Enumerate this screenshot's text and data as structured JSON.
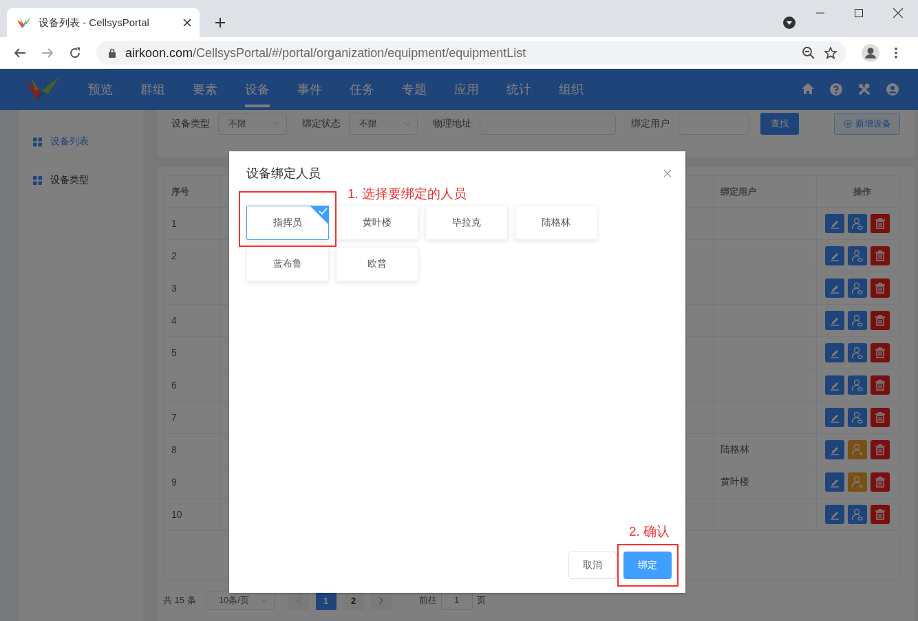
{
  "browser": {
    "tab_title": "设备列表 - CellsysPortal",
    "url_host": "airkoon.com",
    "url_path": "/CellsysPortal/#/portal/organization/equipment/equipmentList"
  },
  "nav": {
    "items": [
      {
        "label": "预览",
        "selected": false
      },
      {
        "label": "群组",
        "selected": false
      },
      {
        "label": "要素",
        "selected": false
      },
      {
        "label": "设备",
        "selected": true
      },
      {
        "label": "事件",
        "selected": false
      },
      {
        "label": "任务",
        "selected": false
      },
      {
        "label": "专题",
        "selected": false
      },
      {
        "label": "应用",
        "selected": false
      },
      {
        "label": "统计",
        "selected": false
      },
      {
        "label": "组织",
        "selected": false
      }
    ]
  },
  "sidebar": {
    "items": [
      {
        "label": "设备列表",
        "selected": true
      },
      {
        "label": "设备类型",
        "selected": false
      }
    ]
  },
  "filters": {
    "fields": [
      {
        "kind": "select",
        "label": "设备类型",
        "value": "不限"
      },
      {
        "kind": "select",
        "label": "绑定状态",
        "value": "不限"
      },
      {
        "kind": "input",
        "label": "物理地址"
      },
      {
        "kind": "input",
        "label": "绑定用户"
      }
    ],
    "search_button": "查找",
    "add_button": "新增设备"
  },
  "table": {
    "columns": [
      "序号",
      "绑定用户",
      "操作"
    ],
    "rows": [
      {
        "index": "1",
        "bound": false
      },
      {
        "index": "2",
        "bound": false
      },
      {
        "index": "3",
        "bound": false
      },
      {
        "index": "4",
        "bound": false
      },
      {
        "index": "5",
        "bound": false
      },
      {
        "index": "6",
        "bound": false
      },
      {
        "index": "7",
        "bound": false
      },
      {
        "index": "8",
        "bound_user": "陆格林",
        "bound": true
      },
      {
        "index": "9",
        "bound_user": "黄叶楼",
        "bound": true
      },
      {
        "index": "10",
        "bound": false
      }
    ]
  },
  "pagination": {
    "total": "共 15 条",
    "page_size": "10条/页",
    "pages": [
      {
        "label": "1",
        "selected": true
      },
      {
        "label": "2",
        "selected": false
      }
    ],
    "goto_label": "前往",
    "goto_value": "1",
    "goto_suffix": "页"
  },
  "dialog": {
    "title": "设备绑定人员",
    "people": [
      {
        "name": "指挥员",
        "selected": true
      },
      {
        "name": "黄叶楼",
        "selected": false
      },
      {
        "name": "毕拉克",
        "selected": false
      },
      {
        "name": "陆格林",
        "selected": false
      },
      {
        "name": "蓝布鲁",
        "selected": false
      },
      {
        "name": "欧普",
        "selected": false
      }
    ],
    "cancel_button": "取消",
    "confirm_button": "绑定"
  },
  "annotations": [
    {
      "text": "1. 选择要绑定的人员"
    },
    {
      "text": "2. 确认"
    }
  ]
}
